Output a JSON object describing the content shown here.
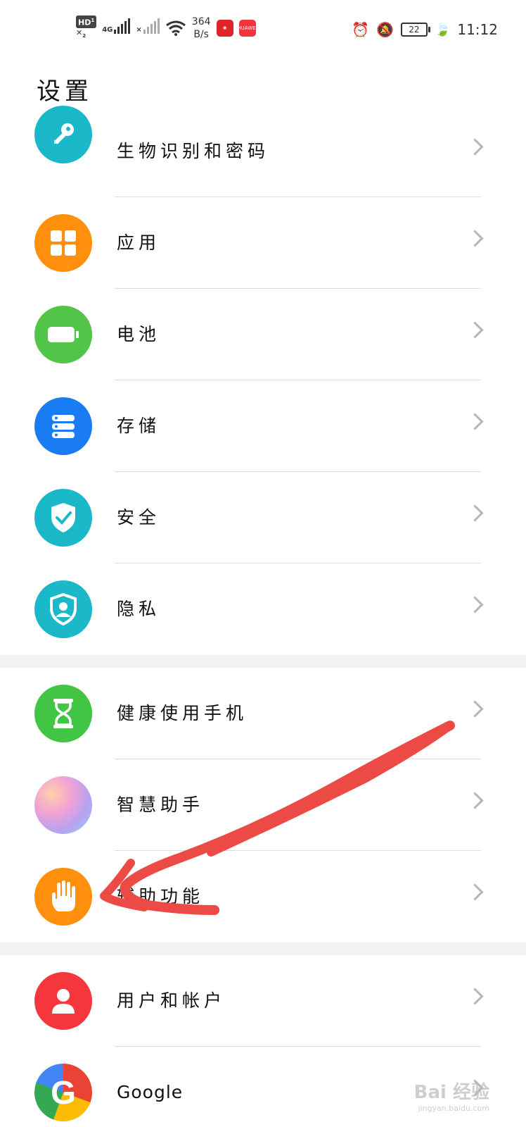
{
  "status_bar": {
    "hd_label": "HD",
    "sim1": "1",
    "sim2": "2",
    "network_type": "4G",
    "speed_value": "364",
    "speed_unit": "B/s",
    "app_badge": "HUAWEI",
    "battery_level": "22",
    "time": "11:12"
  },
  "page_title": "设置",
  "groups": [
    {
      "items": [
        {
          "label": "生物识别和密码",
          "icon": "key-icon",
          "color": "#1bb8c9"
        },
        {
          "label": "应用",
          "icon": "apps-grid-icon",
          "color": "#ff8f0c"
        },
        {
          "label": "电池",
          "icon": "battery-icon",
          "color": "#52c447"
        },
        {
          "label": "存储",
          "icon": "storage-icon",
          "color": "#1a7cf2"
        },
        {
          "label": "安全",
          "icon": "shield-check-icon",
          "color": "#1bb8c9"
        },
        {
          "label": "隐私",
          "icon": "privacy-shield-icon",
          "color": "#1bb8c9"
        }
      ]
    },
    {
      "items": [
        {
          "label": "健康使用手机",
          "icon": "hourglass-icon",
          "color": "#42c444"
        },
        {
          "label": "智慧助手",
          "icon": "smart-assistant-icon",
          "color": "#c6a6f0"
        },
        {
          "label": "辅助功能",
          "icon": "hand-icon",
          "color": "#ff8f0c"
        }
      ]
    },
    {
      "items": [
        {
          "label": "用户和帐户",
          "icon": "user-icon",
          "color": "#f5363d"
        },
        {
          "label": "Google",
          "icon": "google-icon",
          "color": "#ea4335"
        }
      ]
    }
  ],
  "watermark": {
    "main": "Bai 经验",
    "sub": "jingyan.baidu.com"
  }
}
